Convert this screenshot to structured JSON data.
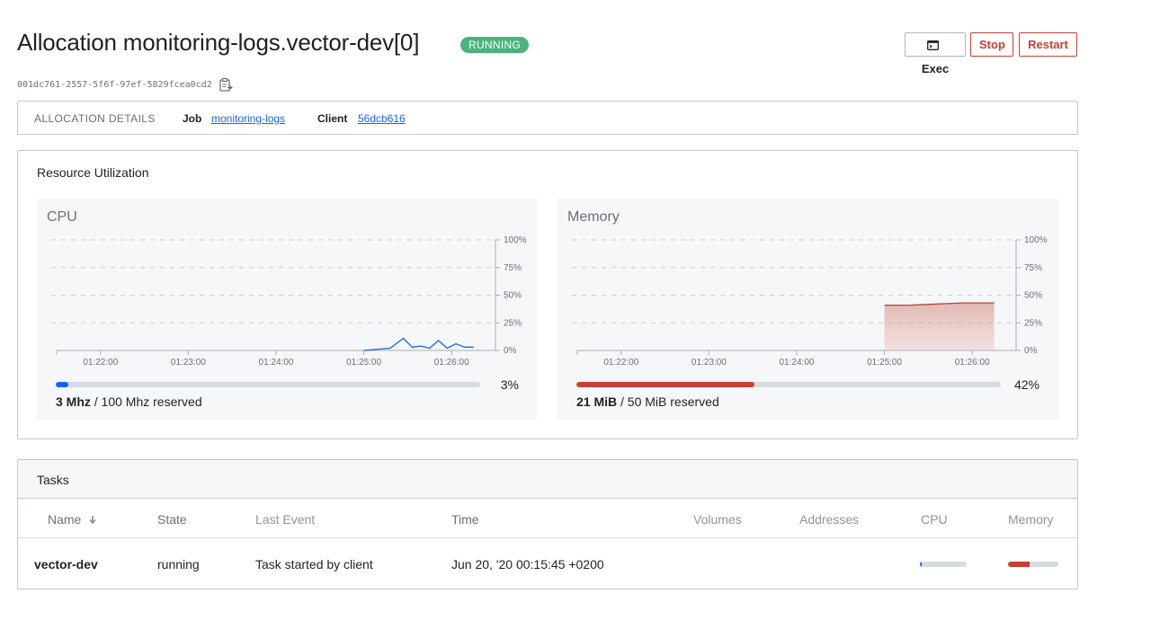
{
  "header": {
    "title": "Allocation monitoring-logs.vector-dev[0]",
    "status": "RUNNING",
    "buttons": {
      "exec": "Exec",
      "stop": "Stop",
      "restart": "Restart"
    },
    "exec_icon": "terminal-icon"
  },
  "allocation_id": "001dc761-2557-5f6f-97ef-5829fcea0cd2",
  "copy_icon": "clipboard-copy-icon",
  "details": {
    "heading": "ALLOCATION DETAILS",
    "job_label": "Job",
    "job_value": "monitoring-logs",
    "client_label": "Client",
    "client_value": "56dcb616"
  },
  "resource": {
    "title": "Resource Utilization",
    "cpu": {
      "title": "CPU",
      "used": "3 Mhz",
      "reserved": "/ 100 Mhz reserved",
      "percent_label": "3%",
      "percent": 3
    },
    "memory": {
      "title": "Memory",
      "used": "21 MiB",
      "reserved": "/ 50 MiB reserved",
      "percent_label": "42%",
      "percent": 42
    }
  },
  "chart_data": [
    {
      "type": "line",
      "title": "CPU",
      "x_ticks": [
        "01:22:00",
        "01:23:00",
        "01:24:00",
        "01:25:00",
        "01:26:00"
      ],
      "y_ticks": [
        "100%",
        "75%",
        "50%",
        "25%",
        "0%"
      ],
      "ylim": [
        0,
        100
      ],
      "x_minutes": [
        1.0,
        1.3,
        1.45,
        1.55,
        1.65,
        1.75,
        1.85,
        1.95,
        2.05,
        2.15,
        2.25
      ],
      "values": [
        0,
        2,
        11,
        3,
        4,
        2,
        9,
        2,
        6,
        3,
        3
      ],
      "xlim_minutes": [
        -2.5,
        2.5
      ],
      "grid": true,
      "color": "#1563ff"
    },
    {
      "type": "area",
      "title": "Memory",
      "x_ticks": [
        "01:22:00",
        "01:23:00",
        "01:24:00",
        "01:25:00",
        "01:26:00"
      ],
      "y_ticks": [
        "100%",
        "75%",
        "50%",
        "25%",
        "0%"
      ],
      "ylim": [
        0,
        100
      ],
      "x_minutes": [
        1.0,
        1.3,
        1.6,
        1.9,
        2.25
      ],
      "values": [
        41,
        41,
        42,
        43,
        43
      ],
      "xlim_minutes": [
        -2.5,
        2.5
      ],
      "grid": true,
      "color": "#b04a3e"
    }
  ],
  "tasks": {
    "title": "Tasks",
    "columns": {
      "name": "Name",
      "state": "State",
      "last_event": "Last Event",
      "time": "Time",
      "volumes": "Volumes",
      "addresses": "Addresses",
      "cpu": "CPU",
      "memory": "Memory"
    },
    "sort_icon": "arrow-down-icon",
    "rows": [
      {
        "name": "vector-dev",
        "state": "running",
        "last_event": "Task started by client",
        "time": "Jun 20, '20 00:15:45 +0200",
        "cpu_percent": 3,
        "memory_percent": 42
      }
    ]
  },
  "colors": {
    "running": "#4ab47d",
    "danger": "#c84034",
    "link": "#1563ff",
    "cpu_bar": "#1563ff",
    "memory_bar": "#c84034"
  }
}
